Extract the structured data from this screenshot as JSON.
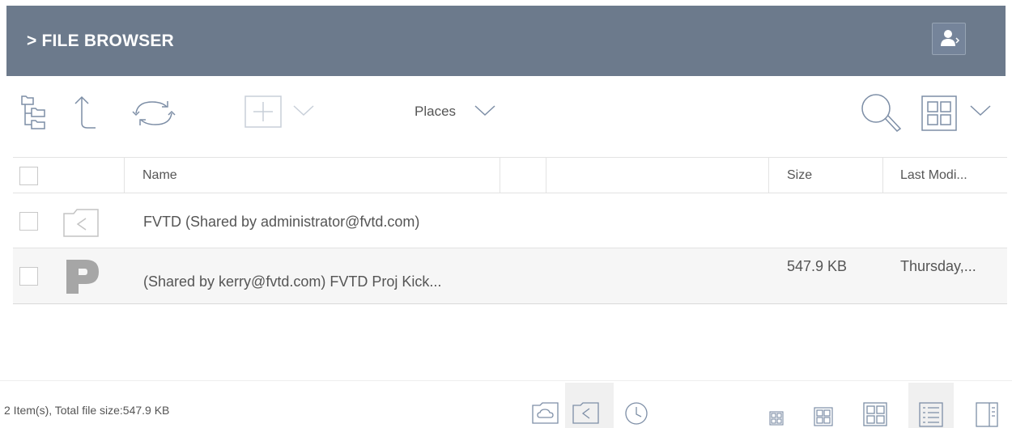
{
  "header": {
    "title": "> FILE BROWSER",
    "user_icon": "user-arrow-icon"
  },
  "toolbar": {
    "tree_icon": "folder-tree-icon",
    "up_icon": "up-arrow-icon",
    "refresh_icon": "refresh-icon",
    "add_icon": "add-icon",
    "add_dropdown_icon": "chevron-down-icon",
    "places_label": "Places",
    "search_icon": "search-icon",
    "view_icon": "grid-view-icon"
  },
  "table": {
    "columns": [
      "Name",
      "",
      "Size",
      "Last Modi..."
    ],
    "rows": [
      {
        "icon": "shared-folder-icon",
        "name": "FVTD (Shared by administrator@fvtd.com)",
        "size": "",
        "modified": ""
      },
      {
        "icon": "powerpoint-file-icon",
        "name": "(Shared by kerry@fvtd.com) FVTD Proj Kick...",
        "size": "547.9 KB",
        "modified": "Thursday,..."
      }
    ]
  },
  "status": {
    "summary": "2 Item(s), Total file size:547.9 KB"
  },
  "bottom_bar": {
    "place_buttons": [
      "cloud-folder-icon",
      "shared-folder-icon",
      "recent-clock-icon"
    ],
    "active_place": "shared-folder-icon",
    "view_buttons": [
      "small-grid-icon",
      "medium-grid-icon",
      "large-grid-icon",
      "list-view-icon",
      "preview-pane-icon"
    ],
    "active_view": "list-view-icon"
  },
  "colors": {
    "header_bg": "#6c7a8c",
    "header_text": "#ffffff",
    "icon_stroke": "#7d8ea6",
    "selected_row_bg": "#f6f6f6"
  }
}
